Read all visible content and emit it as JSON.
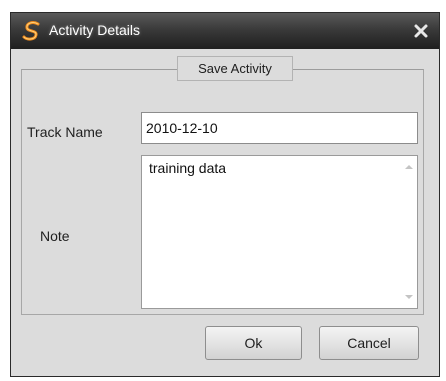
{
  "window": {
    "title": "Activity Details",
    "app_icon": "s-logo-icon",
    "close_icon": "close-icon"
  },
  "group": {
    "title": "Save Activity"
  },
  "form": {
    "track_name_label": "Track Name",
    "track_name_value": "2010-12-10",
    "note_label": "Note",
    "note_value": "training data"
  },
  "buttons": {
    "ok_label": "Ok",
    "cancel_label": "Cancel"
  },
  "colors": {
    "titlebar": "#2b2b2b",
    "window_bg": "#dcdcdc",
    "app_icon_accent": "#f08a1c"
  }
}
